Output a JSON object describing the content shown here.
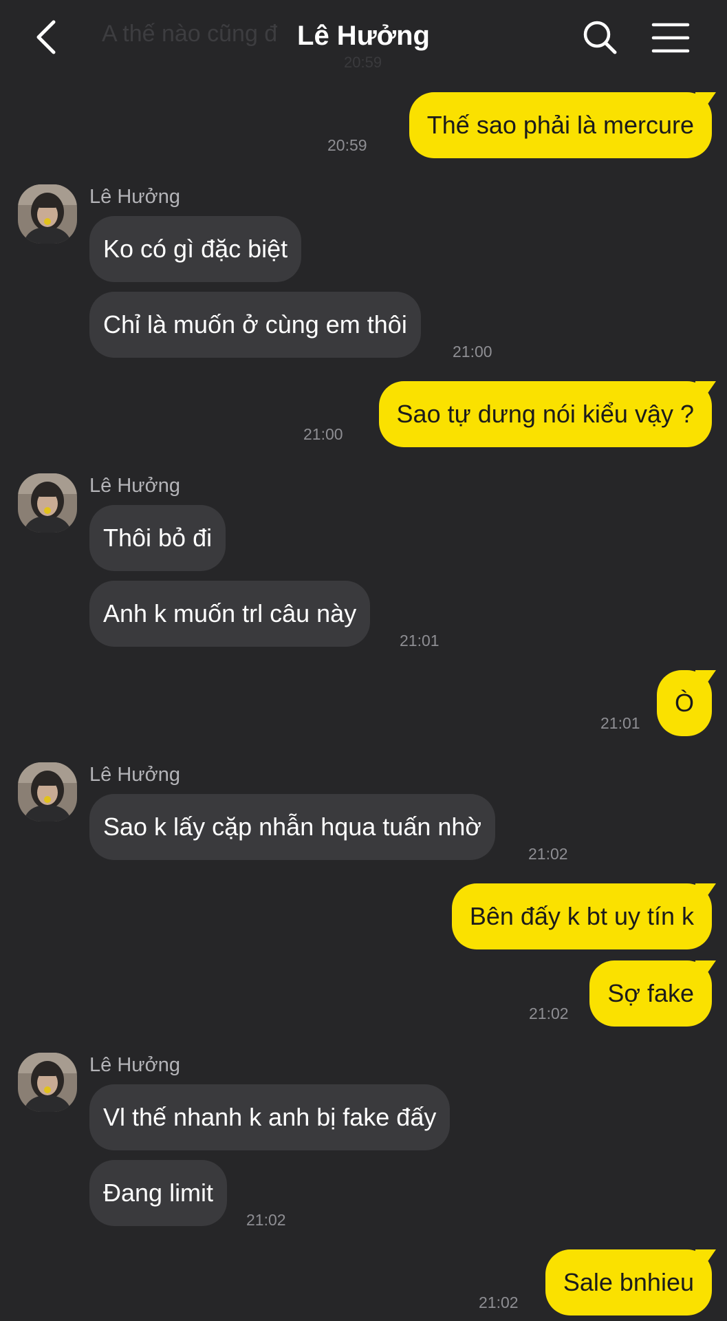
{
  "header": {
    "title": "Lê Hưởng",
    "ghost_text": "A thế nào cũng đ",
    "ghost_time": "20:59"
  },
  "contact": {
    "name": "Lê Hưởng"
  },
  "messages": [
    {
      "from": "me",
      "text": "Thế sao phải là mercure",
      "time": "20:59"
    },
    {
      "from": "them",
      "text": "Ko có gì đặc biệt"
    },
    {
      "from": "them",
      "text": "Chỉ là muốn ở cùng em thôi",
      "time": "21:00"
    },
    {
      "from": "me",
      "text": "Sao tự dưng nói kiểu vậy ?",
      "time": "21:00"
    },
    {
      "from": "them",
      "text": "Thôi bỏ đi"
    },
    {
      "from": "them",
      "text": "Anh k muốn trl câu này",
      "time": "21:01"
    },
    {
      "from": "me",
      "text": "Ò",
      "time": "21:01"
    },
    {
      "from": "them",
      "text": "Sao k lấy cặp nhẫn hqua tuấn nhờ",
      "time": "21:02"
    },
    {
      "from": "me",
      "text": "Bên đấy k bt uy tín k"
    },
    {
      "from": "me",
      "text": "Sợ fake",
      "time": "21:02"
    },
    {
      "from": "them",
      "text": "Vl thế nhanh k anh bị fake đấy"
    },
    {
      "from": "them",
      "text": "Đang limit",
      "time": "21:02"
    },
    {
      "from": "me",
      "text": "Sale bnhieu",
      "time": "21:02"
    }
  ],
  "colors": {
    "background": "#262628",
    "outgoing_bubble": "#fae100",
    "incoming_bubble": "#3a3a3d",
    "timestamp": "#8e8e93"
  },
  "icons": {
    "back": "chevron-left-icon",
    "search": "search-icon",
    "menu": "hamburger-menu-icon"
  }
}
